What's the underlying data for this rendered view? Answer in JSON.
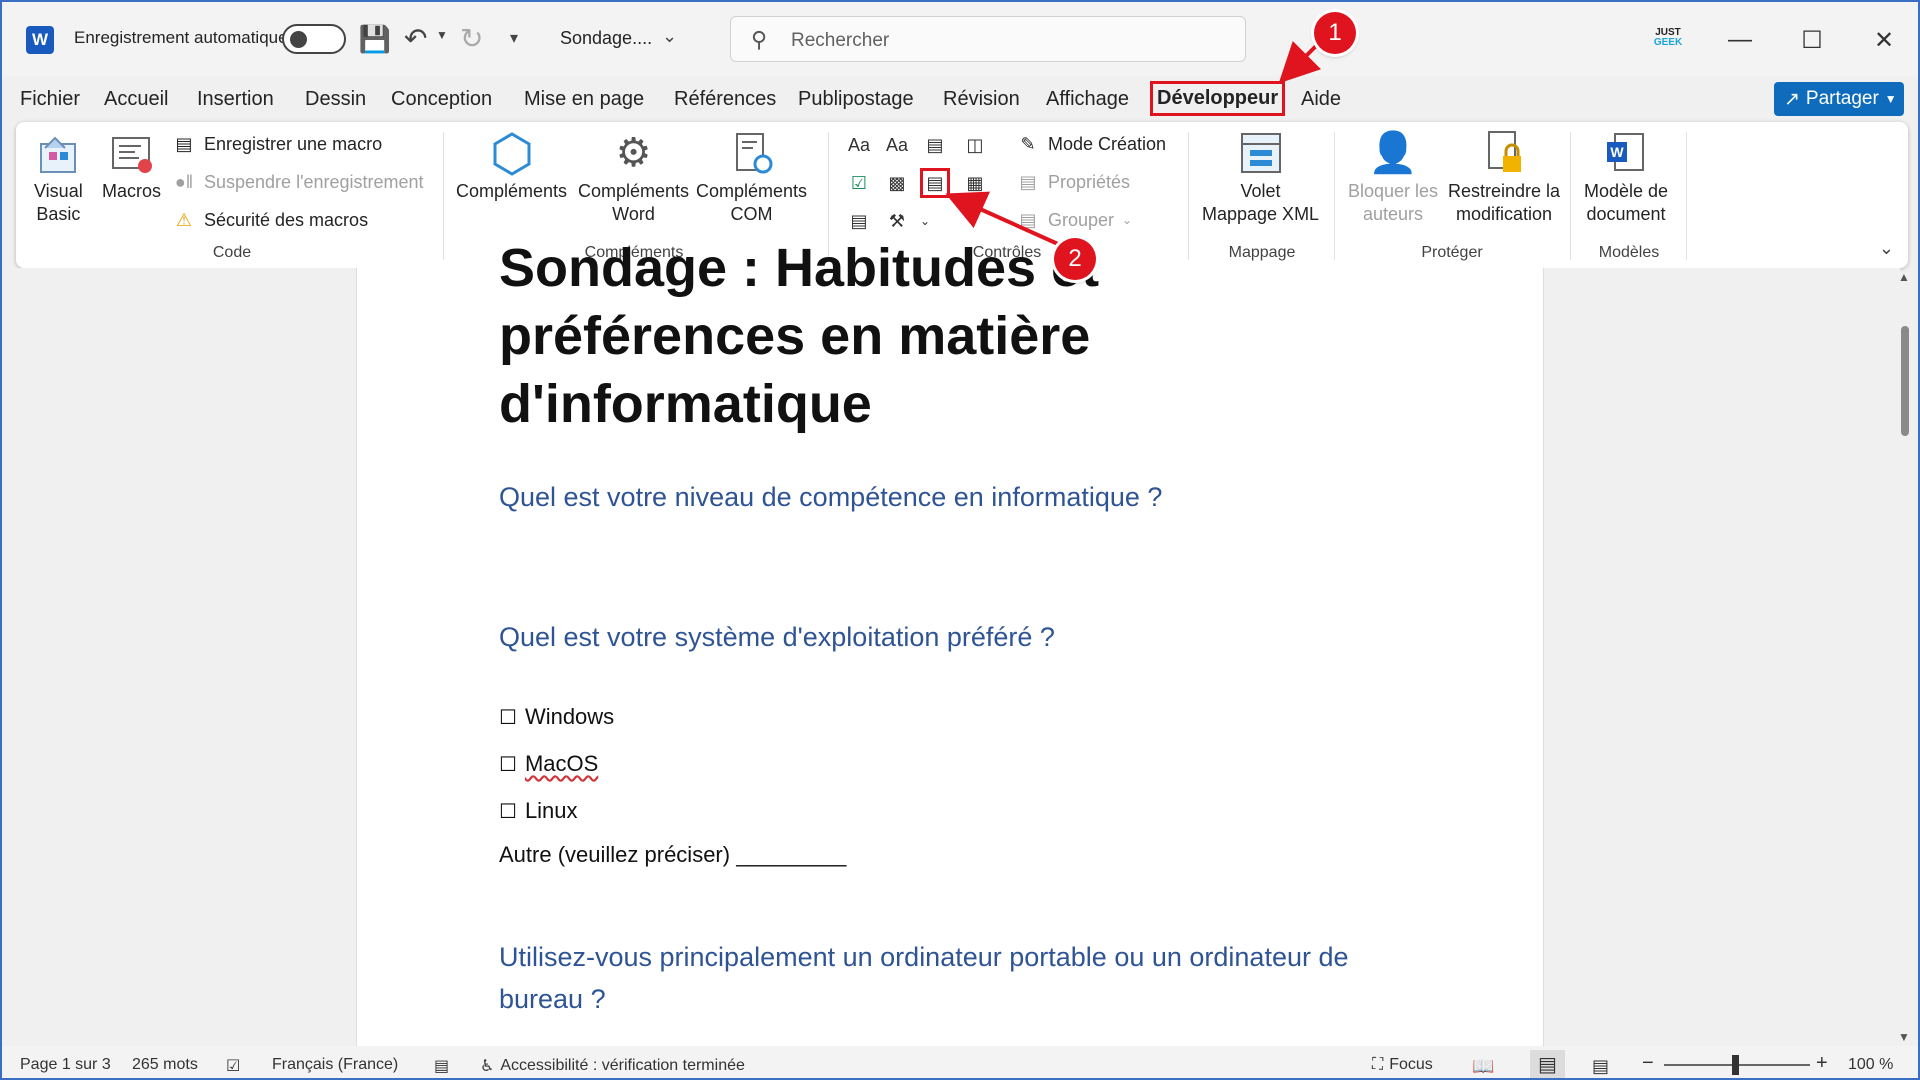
{
  "titlebar": {
    "autosave_label": "Enregistrement automatique",
    "document_name": "Sondage....",
    "search_placeholder": "Rechercher",
    "brand_top": "JUST",
    "brand_bottom": "GEEK"
  },
  "menu": {
    "tabs": [
      "Fichier",
      "Accueil",
      "Insertion",
      "Dessin",
      "Conception",
      "Mise en page",
      "Références",
      "Publipostage",
      "Révision",
      "Affichage",
      "Développeur",
      "Aide"
    ],
    "share_label": "Partager"
  },
  "ribbon": {
    "code": {
      "label": "Code",
      "visual_basic": [
        "Visual",
        "Basic"
      ],
      "macros": "Macros",
      "record_macro": "Enregistrer une macro",
      "pause_recording": "Suspendre l'enregistrement",
      "macro_security": "Sécurité des macros"
    },
    "addins": {
      "label": "Compléments",
      "complements": "Compléments",
      "word_addins": [
        "Compléments",
        "Word"
      ],
      "com_addins": [
        "Compléments",
        "COM"
      ]
    },
    "controls": {
      "label": "Contrôles",
      "design_mode": "Mode Création",
      "properties": "Propriétés",
      "group": "Grouper"
    },
    "mapping": {
      "label": "Mappage",
      "xml_pane": [
        "Volet",
        "Mappage XML"
      ]
    },
    "protect": {
      "label": "Protéger",
      "block_authors": [
        "Bloquer les",
        "auteurs"
      ],
      "restrict_editing": [
        "Restreindre la",
        "modification"
      ]
    },
    "templates": {
      "label": "Modèles",
      "document_template": [
        "Modèle de",
        "document"
      ]
    }
  },
  "document": {
    "title": "Sondage : Habitudes et préférences en matière d'informatique",
    "q1": "Quel est votre niveau de compétence en informatique ?",
    "q2": "Quel est votre système d'exploitation préféré ?",
    "options": [
      "Windows",
      "MacOS",
      "Linux"
    ],
    "other": "Autre (veuillez préciser) _________",
    "q3": "Utilisez-vous principalement un ordinateur portable ou un ordinateur de bureau ?"
  },
  "statusbar": {
    "page": "Page 1 sur 3",
    "words": "265 mots",
    "language": "Français (France)",
    "accessibility": "Accessibilité : vérification terminée",
    "focus": "Focus",
    "zoom": "100 %"
  },
  "annotations": {
    "badge1": "1",
    "badge2": "2",
    "color": "#e0141e"
  }
}
